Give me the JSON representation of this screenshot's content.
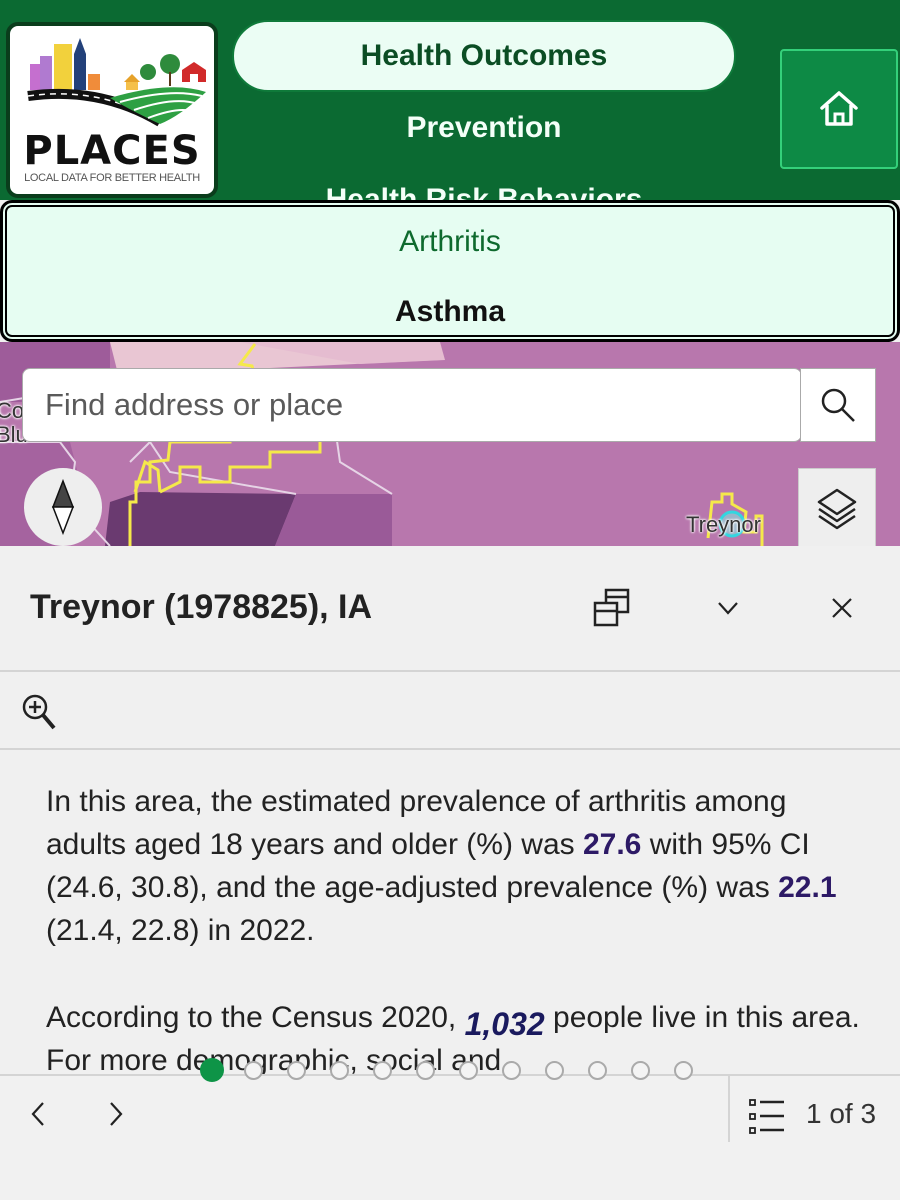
{
  "header": {
    "logo": {
      "title": "PLACES",
      "subtitle": "LOCAL DATA FOR BETTER HEALTH"
    },
    "categories": [
      {
        "label": "Health Outcomes",
        "selected": true
      },
      {
        "label": "Prevention",
        "selected": false
      },
      {
        "label": "Health Risk Behaviors",
        "selected": false
      }
    ],
    "home_icon": "home-icon"
  },
  "topics": [
    {
      "label": "Arthritis",
      "selected": true
    },
    {
      "label": "Asthma",
      "selected": false
    }
  ],
  "map": {
    "search": {
      "placeholder": "Find address or place",
      "value": ""
    },
    "labels": {
      "treynor": "Treynor",
      "council_bluffs_1": "Cou",
      "council_bluffs_2": "Blu"
    },
    "colors": {
      "base": "#b877ad",
      "dark": "#6a3a70",
      "light": "#e9c6d3",
      "boundary": "#f5e94a"
    }
  },
  "popup": {
    "title": "Treynor (1978825), IA",
    "paragraph1": {
      "part1": "In this area, the estimated prevalence of arthritis among adults aged 18 years and older (%) was ",
      "value1": "27.6",
      "part2": " with 95% CI (24.6, 30.8), and the age-adjusted prevalence (%) was ",
      "value2": "22.1",
      "part3": " (21.4, 22.8) in 2022."
    },
    "paragraph2": {
      "part1": "According to the Census 2020, ",
      "population": "1,032",
      "part2": " people live in this area. For more demographic, social and"
    }
  },
  "pagination": {
    "dots_total": 12,
    "dots_active": 1,
    "page_text": "1 of 3"
  },
  "colors": {
    "brand_green": "#0b6a32",
    "accent_green": "#0e9447",
    "highlight": "#2d1a66"
  }
}
